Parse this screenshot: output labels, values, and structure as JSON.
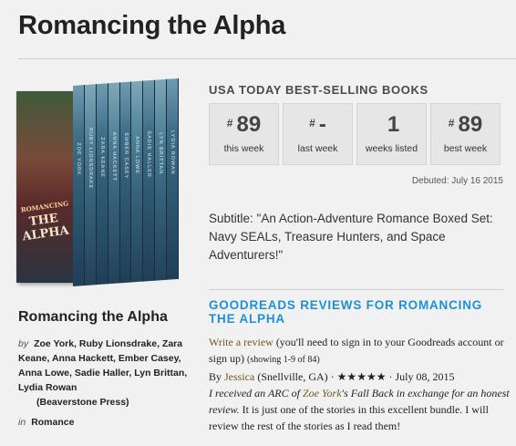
{
  "page_title": "Romancing the Alpha",
  "cover": {
    "front_line1": "ROMANCING",
    "front_line2": "THE ALPHA",
    "spines": [
      "ZOE YORK",
      "RUBY LIONSDRAKE",
      "ZARA KEANE",
      "ANNA HACKETT",
      "EMBER CASEY",
      "ANNA LOWE",
      "SADIE HALLER",
      "LYN BRITTAN",
      "LYDIA ROWAN"
    ]
  },
  "book": {
    "title": "Romancing the Alpha",
    "by_label": "by",
    "authors": "Zoe York, Ruby Lionsdrake, Zara Keane, Anna Hackett, Ember Casey, Anna Lowe, Sadie Haller, Lyn Brittan, Lydia Rowan",
    "publisher": "(Beaverstone Press)",
    "in_label": "in",
    "genre": "Romance"
  },
  "usa_today": {
    "heading": "USA TODAY BEST-SELLING BOOKS",
    "stats": [
      {
        "prefix": "#",
        "value": "89",
        "label": "this week"
      },
      {
        "prefix": "#",
        "value": "-",
        "label": "last week"
      },
      {
        "prefix": "",
        "value": "1",
        "label": "weeks listed"
      },
      {
        "prefix": "#",
        "value": "89",
        "label": "best week"
      }
    ],
    "debuted": "Debuted: July 16 2015"
  },
  "subtitle": "Subtitle: \"An Action-Adventure Romance Boxed Set: Navy SEALs, Treasure Hunters, and Space Adventurers!\"",
  "goodreads": {
    "heading": "GOODREADS REVIEWS FOR ROMANCING THE ALPHA",
    "write_review": "Write a review",
    "signin_note": " (you'll need to sign in to your Goodreads account or sign up) ",
    "showing": "(showing 1-9 of 84)",
    "by_label": "By ",
    "reviewer": "Jessica",
    "location": " (Snellville, GA) · ",
    "stars": "★★★★★",
    "date": " · July 08, 2015",
    "review_part1": "I received an ARC of ",
    "review_author": "Zoe York",
    "review_part2": "'s Fall Back in exchange for an honest review.",
    "review_part3": " It is just one of the stories in this excellent bundle. I will review the rest of the stories as I read them!"
  }
}
